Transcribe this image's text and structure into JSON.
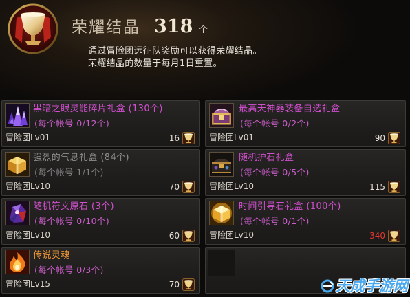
{
  "header": {
    "currency_icon": "glory-crystal-icon",
    "currency_name": "荣耀结晶",
    "amount": "318",
    "unit": "个",
    "description_line1": "通过冒险团远征队奖励可以获得荣耀结晶。",
    "description_line2": "荣耀结晶的数量于每月1日重置。"
  },
  "price_icon": "glory-crystal-coin-icon",
  "items": [
    {
      "icon": "crystal-shards-icon",
      "name": "黑暗之眼灵能碎片礼盒 (130个)",
      "limit": "(每个帐号 0/12个)",
      "level": "冒险团Lv01",
      "price": "16",
      "name_color": "#d24fd0",
      "limit_color": "#c85cc8",
      "price_color": "#e6e0d6"
    },
    {
      "icon": "treasure-chest-icon",
      "name": "最高天神器装备自选礼盒",
      "limit": "(每个帐号 0/2个)",
      "level": "冒险团Lv01",
      "price": "90",
      "name_color": "#d24fd0",
      "limit_color": "#c85cc8",
      "price_color": "#e6e0d6"
    },
    {
      "icon": "gold-box-icon",
      "name": "强烈的气息礼盒 (84个)",
      "limit": "(每个帐号 1/1个)",
      "level": "冒险团Lv10",
      "price": "70",
      "name_color": "#8d8d8d",
      "limit_color": "#7f7f7f",
      "price_color": "#e6e0d6"
    },
    {
      "icon": "dark-chest-icon",
      "name": "随机护石礼盒",
      "limit": "(每个帐号 0/5个)",
      "level": "冒险团Lv10",
      "price": "115",
      "name_color": "#d24fd0",
      "limit_color": "#c85cc8",
      "price_color": "#e6e0d6"
    },
    {
      "icon": "rune-stone-icon",
      "name": "随机符文原石 (3个)",
      "limit": "(每个帐号 0/10个)",
      "level": "冒险团Lv10",
      "price": "60",
      "name_color": "#d24fd0",
      "limit_color": "#c85cc8",
      "price_color": "#e6e0d6"
    },
    {
      "icon": "glowing-box-icon",
      "name": "时间引导石礼盒 (100个)",
      "limit": "(每个帐号 0/1个)",
      "level": "冒险团Lv10",
      "price": "340",
      "name_color": "#d24fd0",
      "limit_color": "#c85cc8",
      "price_color": "#e2382e"
    },
    {
      "icon": "fire-soul-icon",
      "name": "传说灵魂",
      "limit": "(每个帐号 0/3个)",
      "level": "冒险团Lv15",
      "price": "70",
      "name_color": "#ec9434",
      "limit_color": "#c85cc8",
      "price_color": "#e6e0d6"
    }
  ],
  "watermark": "天成手游网",
  "colors": {
    "background": "#0d0b0a",
    "card_background": "#1e1d1c",
    "card_border": "#3c3a37",
    "item_name_magenta": "#d24fd0",
    "unavailable_gray": "#8d8d8d",
    "legendary_orange": "#ec9434",
    "insufficient_price_red": "#e2382e",
    "watermark_blue": "#49a8ee"
  }
}
